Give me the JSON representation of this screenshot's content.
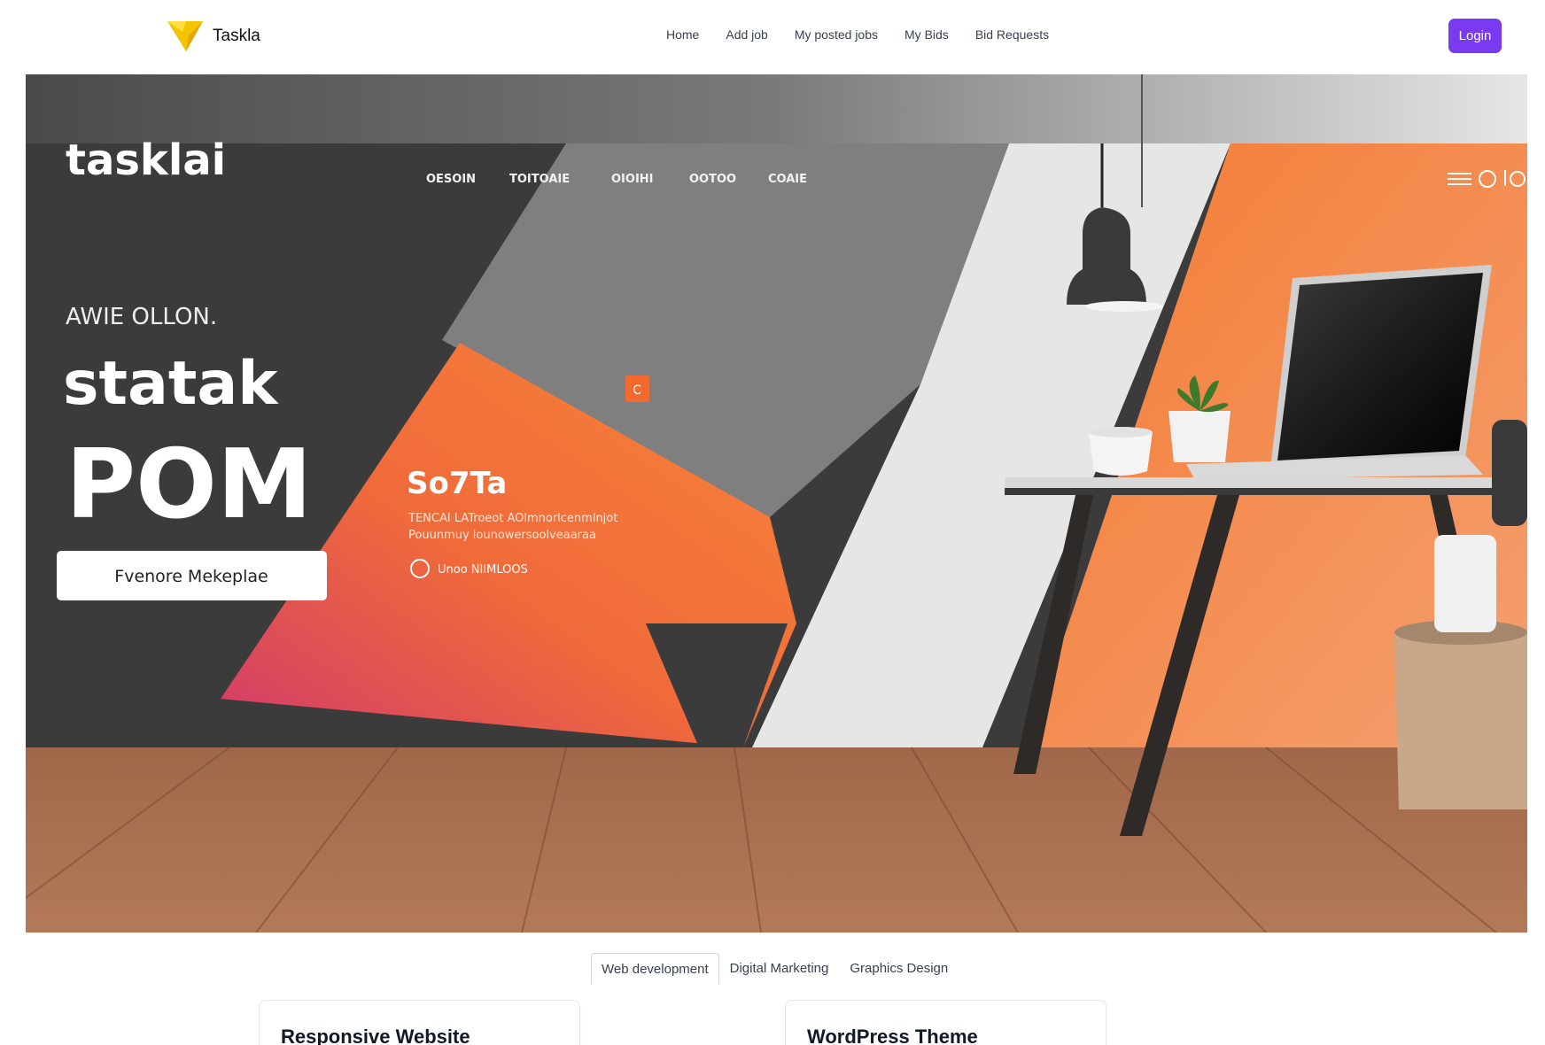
{
  "navbar": {
    "brand_name": "Taskla",
    "brand_color": "#facc15",
    "links": [
      {
        "label": "Home"
      },
      {
        "label": "Add job"
      },
      {
        "label": "My posted jobs"
      },
      {
        "label": "My Bids"
      },
      {
        "label": "Bid Requests"
      }
    ],
    "login_label": "Login",
    "accent_color": "#7a3af0"
  },
  "hero": {
    "logo_text": "tasklai",
    "menu_items": [
      "OESOIN",
      "TOITOAIE",
      "OIOIHI",
      "OOTOO",
      "COAIE"
    ],
    "small_heading": "AWIE OLLON.",
    "headline_1": "statak",
    "headline_2": "POM",
    "button_label": "Fvenore Mekeplae",
    "orange_title": "So7Ta",
    "orange_line_1": "TENCAI LATroeot AOlmnorlcenmlnjot",
    "orange_line_2": "Pouunmuy lounowersoolveaaraa",
    "orange_link": "Unoo NIIMLOOS",
    "orange_badge": "C"
  },
  "tabs": [
    {
      "label": "Web development",
      "active": true
    },
    {
      "label": "Digital Marketing",
      "active": false
    },
    {
      "label": "Graphics Design",
      "active": false
    }
  ],
  "cards": [
    {
      "title": "Responsive Website"
    },
    {
      "title": "WordPress Theme"
    }
  ]
}
